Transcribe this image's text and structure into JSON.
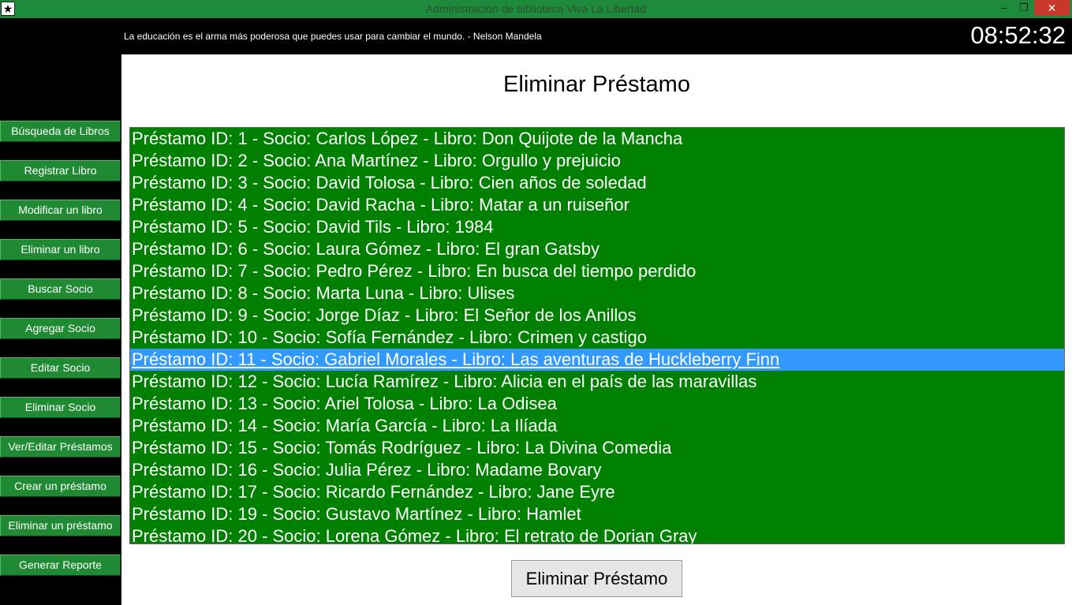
{
  "window": {
    "title": "Administración de biblioteca Viva La Libertad",
    "app_icon": "star-icon",
    "minimize_glyph": "–",
    "maximize_glyph": "❐",
    "close_glyph": "✕"
  },
  "header": {
    "quote": "La educación es el arma más poderosa que puedes usar para cambiar el mundo. - Nelson Mandela",
    "clock": "08:52:32"
  },
  "sidebar": {
    "items": [
      {
        "label": "Búsqueda de Libros"
      },
      {
        "label": "Registrar Libro"
      },
      {
        "label": "Modificar un libro"
      },
      {
        "label": "Eliminar un libro"
      },
      {
        "label": "Buscar Socio"
      },
      {
        "label": "Agregar Socio"
      },
      {
        "label": "Editar Socio"
      },
      {
        "label": "Eliminar Socio"
      },
      {
        "label": "Ver/Editar Préstamos"
      },
      {
        "label": "Crear un préstamo"
      },
      {
        "label": "Eliminar un préstamo"
      },
      {
        "label": "Generar Reporte"
      }
    ]
  },
  "main": {
    "title": "Eliminar Préstamo",
    "selected_index": 10,
    "loans": [
      "Préstamo ID: 1 - Socio: Carlos López - Libro: Don Quijote de la Mancha",
      "Préstamo ID: 2 - Socio: Ana Martínez - Libro: Orgullo y prejuicio",
      "Préstamo ID: 3 - Socio: David Tolosa - Libro: Cien años de soledad",
      "Préstamo ID: 4 - Socio: David Racha - Libro: Matar a un ruiseñor",
      "Préstamo ID: 5 - Socio: David Tils - Libro: 1984",
      "Préstamo ID: 6 - Socio: Laura Gómez - Libro: El gran Gatsby",
      "Préstamo ID: 7 - Socio: Pedro Pérez - Libro: En busca del tiempo perdido",
      "Préstamo ID: 8 - Socio: Marta Luna - Libro: Ulises",
      "Préstamo ID: 9 - Socio: Jorge Díaz - Libro: El Señor de los Anillos",
      "Préstamo ID: 10 - Socio: Sofía Fernández - Libro: Crimen y castigo",
      "Préstamo ID: 11 - Socio: Gabriel Morales - Libro: Las aventuras de Huckleberry Finn",
      "Préstamo ID: 12 - Socio: Lucía Ramírez - Libro: Alicia en el país de las maravillas",
      "Préstamo ID: 13 - Socio: Ariel Tolosa - Libro: La Odisea",
      "Préstamo ID: 14 - Socio: María García - Libro: La Ilíada",
      "Préstamo ID: 15 - Socio: Tomás Rodríguez - Libro: La Divina Comedia",
      "Préstamo ID: 16 - Socio: Julia Pérez - Libro: Madame Bovary",
      "Préstamo ID: 17 - Socio: Ricardo Fernández - Libro: Jane Eyre",
      "Préstamo ID: 19 - Socio: Gustavo Martínez - Libro: Hamlet",
      "Préstamo ID: 20 - Socio: Lorena Gómez - Libro: El retrato de Dorian Gray"
    ],
    "action_label": "Eliminar Préstamo"
  },
  "colors": {
    "titlebar": "#1e8b3c",
    "sidebar_button": "#1f8a33",
    "listbox": "#008000",
    "selection": "#3399ff",
    "close_button": "#c7382a"
  }
}
